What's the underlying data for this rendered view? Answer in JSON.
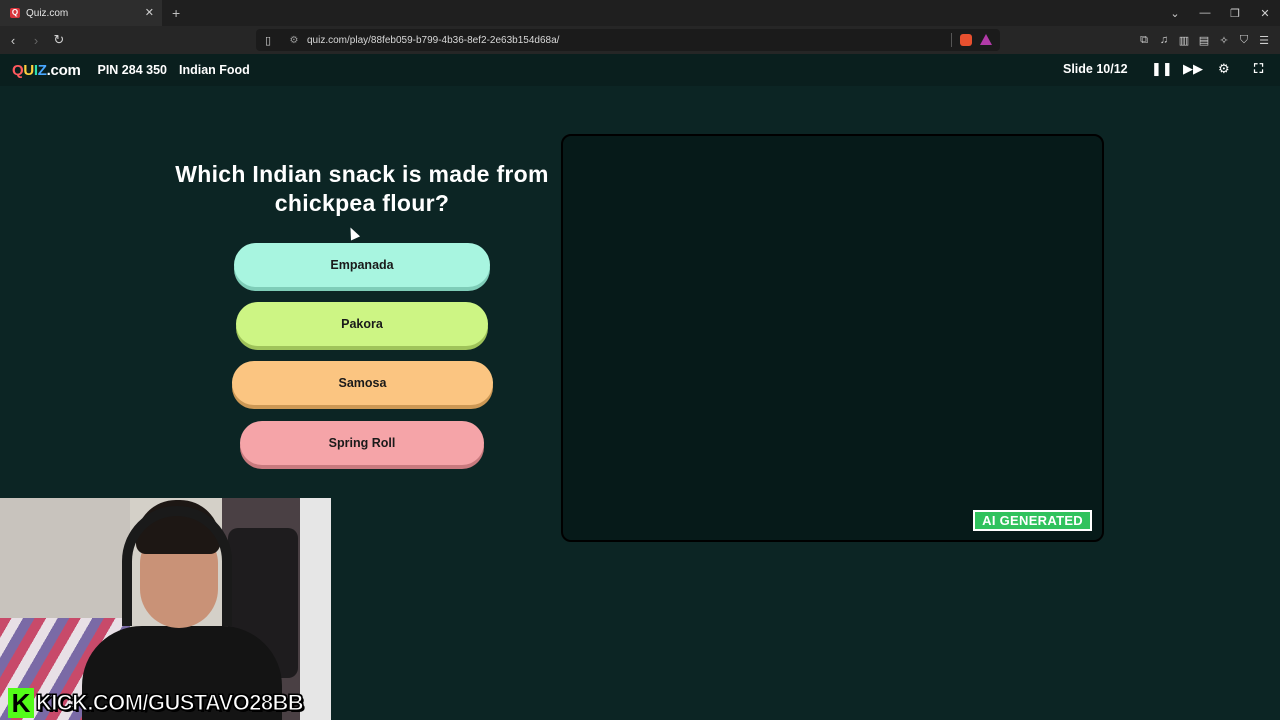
{
  "browser": {
    "tab_title": "Quiz.com",
    "tab_favicon": "Q",
    "new_tab": "+",
    "url": "quiz.com/play/88feb059-b799-4b36-8ef2-2e63b154d68a/"
  },
  "app": {
    "logo": {
      "part1": "Q",
      "part2": "U",
      "part3": "I",
      "part4": "Z",
      "part5": ".com"
    },
    "pin": "PIN 284 350",
    "quiz_title": "Indian Food",
    "slide_counter": "Slide 10/12"
  },
  "question": {
    "text": "Which Indian snack is made from chickpea flour?"
  },
  "answers": [
    {
      "label": "Empanada",
      "color": "#a8f5e0"
    },
    {
      "label": "Pakora",
      "color": "#cdf584"
    },
    {
      "label": "Samosa",
      "color": "#fbc581"
    },
    {
      "label": "Spring Roll",
      "color": "#f5a4a8"
    }
  ],
  "image_panel": {
    "badge": "AI GENERATED",
    "badge_color": "#30c25d"
  },
  "webcam": {
    "kick_logo": "K",
    "kick_url": "KICK.COM/GUSTAVO28BB",
    "kick_color": "#53fc18"
  },
  "icons": {
    "back": "back-arrow-icon",
    "forward": "forward-arrow-icon",
    "reload": "reload-icon",
    "pause": "pause-icon",
    "skip": "fast-forward-icon",
    "settings": "gear-icon",
    "fullscreen": "fullscreen-icon"
  }
}
